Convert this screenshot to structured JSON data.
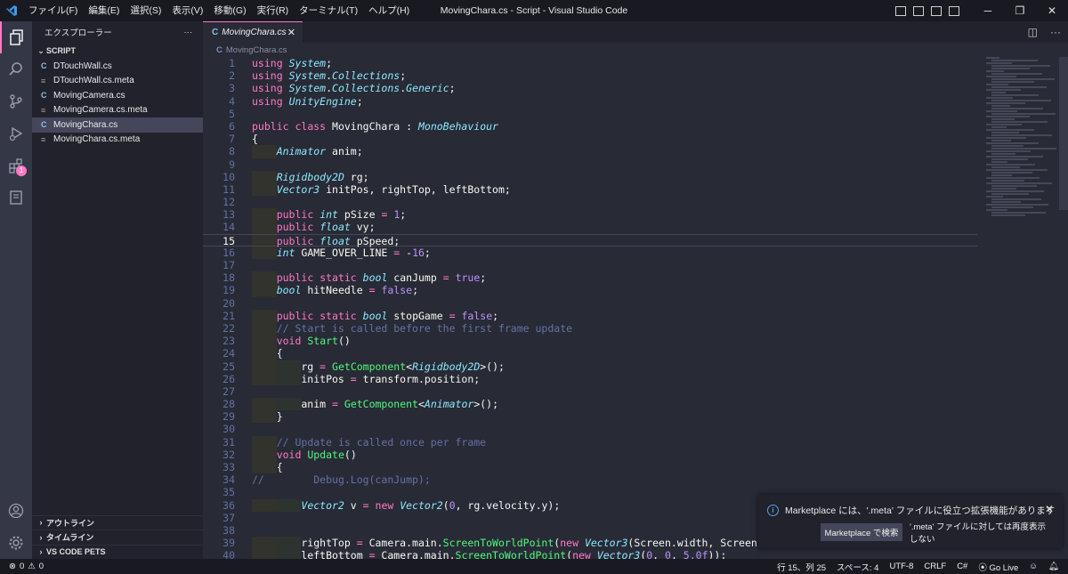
{
  "titlebar": {
    "menu": [
      "ファイル(F)",
      "編集(E)",
      "選択(S)",
      "表示(V)",
      "移動(G)",
      "実行(R)",
      "ターミナル(T)",
      "ヘルプ(H)"
    ],
    "title": "MovingChara.cs - Script - Visual Studio Code"
  },
  "activity": {
    "extensions_badge": "1"
  },
  "sidebar": {
    "header": "エクスプローラー",
    "header_more": "···",
    "folder": "SCRIPT",
    "files": [
      {
        "name": "DTouchWall.cs",
        "icon": "csharp-icon"
      },
      {
        "name": "DTouchWall.cs.meta",
        "icon": "file-lines-icon"
      },
      {
        "name": "MovingCamera.cs",
        "icon": "csharp-icon"
      },
      {
        "name": "MovingCamera.cs.meta",
        "icon": "file-lines-icon"
      },
      {
        "name": "MovingChara.cs",
        "icon": "csharp-icon"
      },
      {
        "name": "MovingChara.cs.meta",
        "icon": "file-lines-icon"
      }
    ],
    "selected_index": 4,
    "bottom_sections": [
      "アウトライン",
      "タイムライン",
      "VS CODE PETS"
    ]
  },
  "editor": {
    "tab": {
      "label": "MovingChara.cs",
      "close": "✕"
    },
    "breadcrumb": "MovingChara.cs",
    "current_line": 15,
    "lines": [
      {
        "n": "1",
        "text": "using System;"
      },
      {
        "n": "2",
        "text": "using System.Collections;"
      },
      {
        "n": "3",
        "text": "using System.Collections.Generic;"
      },
      {
        "n": "4",
        "text": "using UnityEngine;"
      },
      {
        "n": "5",
        "text": ""
      },
      {
        "n": "6",
        "text": "public class MovingChara : MonoBehaviour"
      },
      {
        "n": "7",
        "text": "{"
      },
      {
        "n": "8",
        "text": "    Animator anim;"
      },
      {
        "n": "9",
        "text": ""
      },
      {
        "n": "10",
        "text": "    Rigidbody2D rg;"
      },
      {
        "n": "11",
        "text": "    Vector3 initPos, rightTop, leftBottom;"
      },
      {
        "n": "12",
        "text": ""
      },
      {
        "n": "13",
        "text": "    public int pSize = 1;"
      },
      {
        "n": "14",
        "text": "    public float vy;"
      },
      {
        "n": "15",
        "text": "    public float pSpeed;"
      },
      {
        "n": "16",
        "text": "    int GAME_OVER_LINE = -16;"
      },
      {
        "n": "17",
        "text": ""
      },
      {
        "n": "18",
        "text": "    public static bool canJump = true;"
      },
      {
        "n": "19",
        "text": "    bool hitNeedle = false;"
      },
      {
        "n": "20",
        "text": ""
      },
      {
        "n": "21",
        "text": "    public static bool stopGame = false;"
      },
      {
        "n": "22",
        "text": "    // Start is called before the first frame update"
      },
      {
        "n": "23",
        "text": "    void Start()"
      },
      {
        "n": "24",
        "text": "    {"
      },
      {
        "n": "25",
        "text": "        rg = GetComponent<Rigidbody2D>();"
      },
      {
        "n": "26",
        "text": "        initPos = transform.position;"
      },
      {
        "n": "27",
        "text": ""
      },
      {
        "n": "28",
        "text": "        anim = GetComponent<Animator>();"
      },
      {
        "n": "29",
        "text": "    }"
      },
      {
        "n": "30",
        "text": ""
      },
      {
        "n": "31",
        "text": "    // Update is called once per frame"
      },
      {
        "n": "32",
        "text": "    void Update()"
      },
      {
        "n": "33",
        "text": "    {"
      },
      {
        "n": "34",
        "text": "//        Debug.Log(canJump);"
      },
      {
        "n": "35",
        "text": ""
      },
      {
        "n": "36",
        "text": "        Vector2 v = new Vector2(0, rg.velocity.y);"
      },
      {
        "n": "37",
        "text": ""
      },
      {
        "n": "38",
        "text": ""
      },
      {
        "n": "39",
        "text": "        rightTop = Camera.main.ScreenToWorldPoint(new Vector3(Screen.width, Screen"
      },
      {
        "n": "40",
        "text": "        leftBottom = Camera.main.ScreenToWorldPoint(new Vector3(0, 0, 5.0f));"
      }
    ]
  },
  "notification": {
    "message": "Marketplace には、'.meta' ファイルに役立つ拡張機能があります",
    "close": "✕",
    "primary_button": "Marketplace で検索",
    "secondary_button": "'.meta' ファイルに対しては再度表示しない"
  },
  "statusbar": {
    "errors": "0",
    "warnings": "0",
    "position": "行 15、列 25",
    "spaces": "スペース: 4",
    "encoding": "UTF-8",
    "eol": "CRLF",
    "language": "C#",
    "golive": "Go Live"
  },
  "colors": {
    "accent": "#ff79c6",
    "editor_bg": "#282a36",
    "sidebar_bg": "#21222c",
    "keyword": "#ff79c6",
    "type": "#8be9fd",
    "function": "#50fa7b",
    "number": "#bd93f9",
    "comment": "#6272a4"
  }
}
